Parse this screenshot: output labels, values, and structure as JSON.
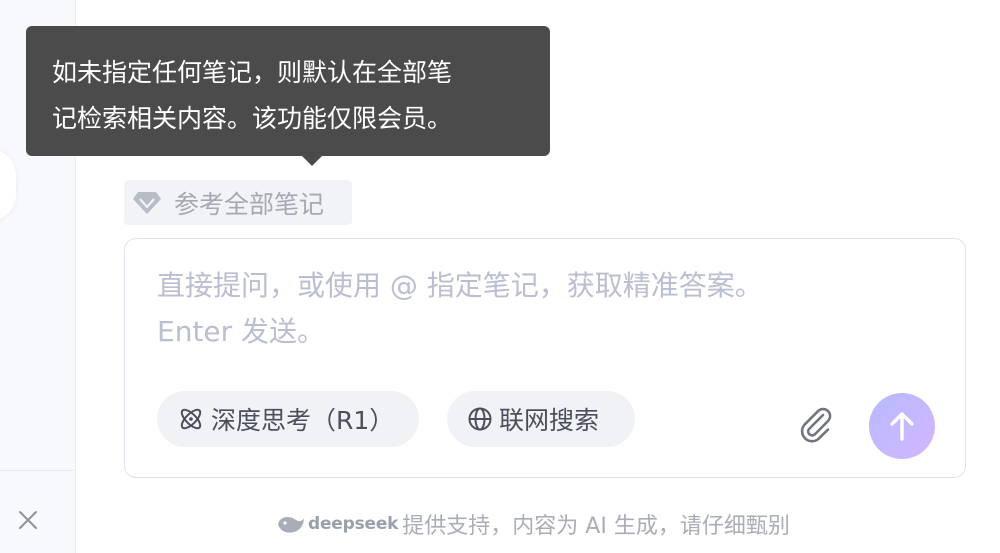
{
  "tooltip": {
    "line1": "如未指定任何笔记，则默认在全部笔",
    "line2": "记检索相关内容。该功能仅限会员。"
  },
  "reference_chip": {
    "icon": "diamond-icon",
    "label": "参考全部笔记"
  },
  "input": {
    "placeholder_line1": "直接提问，或使用 @ 指定笔记，获取精准答案。",
    "placeholder_line2": "Enter 发送。"
  },
  "toolbar": {
    "deep_think_label": "深度思考（R1）",
    "web_search_label": "联网搜索",
    "attach_icon": "paperclip-icon",
    "send_icon": "arrow-up-icon"
  },
  "footer": {
    "brand": "deepseek",
    "text": "提供支持，内容为 AI 生成，请仔细甄别"
  },
  "colors": {
    "tooltip_bg": "#4b4b4b",
    "send_gradient_start": "#b7baff",
    "send_gradient_end": "#d3b6ff"
  }
}
